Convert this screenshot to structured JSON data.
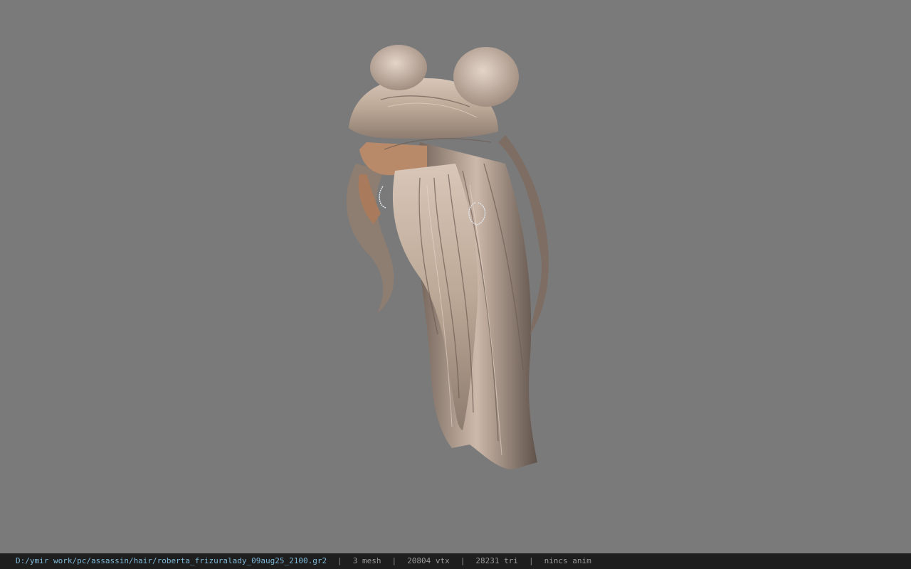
{
  "status_bar": {
    "file_path": "D:/ymir work/pc/assassin/hair/roberta_frizuralady_09aug25_2100.gr2",
    "separator": "|",
    "mesh_count": "3 mesh",
    "vertex_count": "20804 vtx",
    "triangle_count": "28231 tri",
    "animation": "nincs anim"
  },
  "colors": {
    "viewport_background": "#7a7a7a",
    "status_background": "#1e1e1e",
    "path_text": "#7fb8d8",
    "stat_text": "#9a9a9a",
    "hair_light": "#d8c6b8",
    "hair_mid": "#b9a392",
    "hair_dark": "#6f5f55",
    "skin": "#b88a6a"
  },
  "viewport": {
    "model_subject": "hair-model"
  }
}
